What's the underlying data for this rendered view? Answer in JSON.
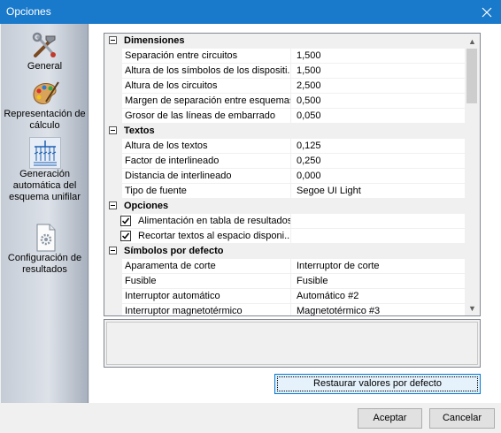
{
  "window": {
    "title": "Opciones"
  },
  "sidebar": {
    "items": [
      {
        "label": "General",
        "icon": "tools-icon"
      },
      {
        "label": "Representación de cálculo",
        "icon": "palette-icon"
      },
      {
        "label": "Generación automática del esquema unifilar",
        "icon": "schematic-icon"
      },
      {
        "label": "Configuración de resultados",
        "icon": "settings-document-icon"
      }
    ]
  },
  "grid": {
    "categories": [
      {
        "name": "Dimensiones",
        "rows": [
          {
            "name": "Separación entre circuitos",
            "value": "1,500"
          },
          {
            "name": "Altura de los símbolos de los dispositi...",
            "value": "1,500"
          },
          {
            "name": "Altura de los circuitos",
            "value": "2,500"
          },
          {
            "name": "Margen de separación entre esquemas:",
            "value": "0,500"
          },
          {
            "name": "Grosor de las líneas de embarrado",
            "value": "0,050"
          }
        ]
      },
      {
        "name": "Textos",
        "rows": [
          {
            "name": "Altura de los textos",
            "value": "0,125"
          },
          {
            "name": "Factor de interlineado",
            "value": "0,250"
          },
          {
            "name": "Distancia de interlineado",
            "value": "0,000"
          },
          {
            "name": "Tipo de fuente",
            "value": "Segoe UI Light"
          }
        ]
      },
      {
        "name": "Opciones",
        "rows": [
          {
            "name": "Alimentación en tabla de resultados",
            "value": "",
            "checked": true
          },
          {
            "name": "Recortar textos al espacio disponi...",
            "value": "",
            "checked": true
          }
        ]
      },
      {
        "name": "Símbolos por defecto",
        "rows": [
          {
            "name": "Aparamenta de corte",
            "value": "Interruptor de corte"
          },
          {
            "name": "Fusible",
            "value": "Fusible"
          },
          {
            "name": "Interruptor automático",
            "value": "Automático #2"
          },
          {
            "name": "Interruptor magnetotérmico",
            "value": "Magnetotérmico #3"
          }
        ]
      }
    ]
  },
  "buttons": {
    "restore": "Restaurar valores por defecto",
    "accept": "Aceptar",
    "cancel": "Cancelar"
  },
  "colors": {
    "titlebar": "#1979ca",
    "focus": "#0078d7"
  }
}
